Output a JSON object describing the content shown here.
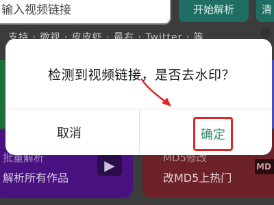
{
  "background": {
    "url_input": {
      "placeholder": "输入视频链接"
    },
    "parse_button_label": "开始解析",
    "clear_button_label": "清",
    "tabs_text": "支持 · 微视 · 皮皮虾 · 最右 · Twitter · 等",
    "cards": [
      {
        "title": "批量解析",
        "subtitle": "解析所有作品",
        "icon": "folder-play-icon",
        "color": "#4a1280"
      },
      {
        "title": "MD5修改",
        "subtitle": "改MD5上热门",
        "icon": "md5-icon",
        "icon_text": "MD",
        "color": "#6c2228"
      }
    ]
  },
  "dialog": {
    "message": "检测到视频链接，是否去水印？",
    "cancel_label": "取消",
    "confirm_label": "确定"
  },
  "annotation": {
    "highlight_color": "#e02626",
    "icon": "red-arrow-icon"
  }
}
